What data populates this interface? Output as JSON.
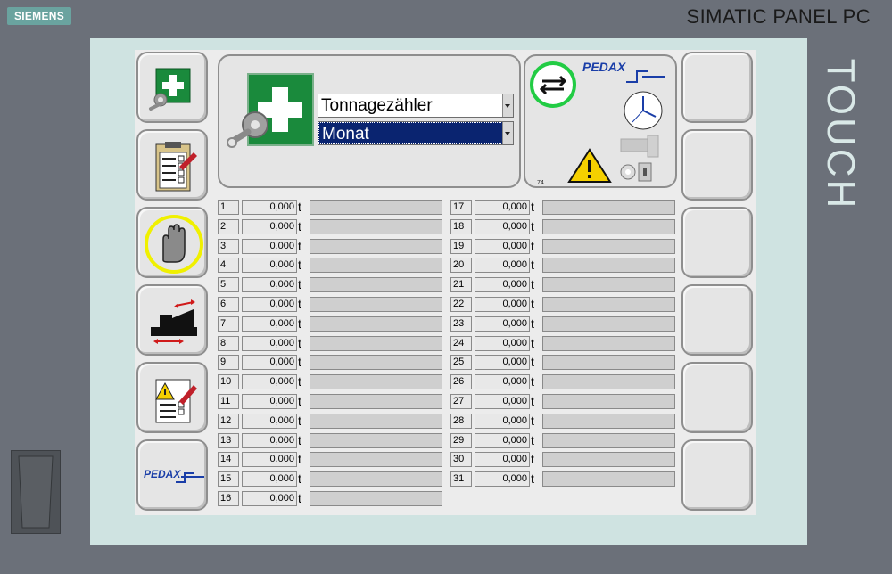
{
  "device": {
    "brand": "SIEMENS",
    "title": "SIMATIC PANEL PC",
    "touch_label": "TOUCH"
  },
  "header": {
    "counter_select": "Tonnagezähler",
    "period_select": "Monat"
  },
  "status_panel": {
    "logo_text": "PEDAX",
    "small_number": "74"
  },
  "left_menu": {
    "pedax_logo": "PEDAX"
  },
  "unit": "t",
  "rows_left": [
    {
      "n": "1",
      "v": "0,000"
    },
    {
      "n": "2",
      "v": "0,000"
    },
    {
      "n": "3",
      "v": "0,000"
    },
    {
      "n": "4",
      "v": "0,000"
    },
    {
      "n": "5",
      "v": "0,000"
    },
    {
      "n": "6",
      "v": "0,000"
    },
    {
      "n": "7",
      "v": "0,000"
    },
    {
      "n": "8",
      "v": "0,000"
    },
    {
      "n": "9",
      "v": "0,000"
    },
    {
      "n": "10",
      "v": "0,000"
    },
    {
      "n": "11",
      "v": "0,000"
    },
    {
      "n": "12",
      "v": "0,000"
    },
    {
      "n": "13",
      "v": "0,000"
    },
    {
      "n": "14",
      "v": "0,000"
    },
    {
      "n": "15",
      "v": "0,000"
    },
    {
      "n": "16",
      "v": "0,000"
    }
  ],
  "rows_right": [
    {
      "n": "17",
      "v": "0,000"
    },
    {
      "n": "18",
      "v": "0,000"
    },
    {
      "n": "19",
      "v": "0,000"
    },
    {
      "n": "20",
      "v": "0,000"
    },
    {
      "n": "21",
      "v": "0,000"
    },
    {
      "n": "22",
      "v": "0,000"
    },
    {
      "n": "23",
      "v": "0,000"
    },
    {
      "n": "24",
      "v": "0,000"
    },
    {
      "n": "25",
      "v": "0,000"
    },
    {
      "n": "26",
      "v": "0,000"
    },
    {
      "n": "27",
      "v": "0,000"
    },
    {
      "n": "28",
      "v": "0,000"
    },
    {
      "n": "29",
      "v": "0,000"
    },
    {
      "n": "30",
      "v": "0,000"
    },
    {
      "n": "31",
      "v": "0,000"
    }
  ],
  "colors": {
    "green": "#1a8a3c",
    "warning": "#f5d000",
    "highlight_ring": "#e8e800",
    "pedax_blue": "#1a3ea8"
  }
}
